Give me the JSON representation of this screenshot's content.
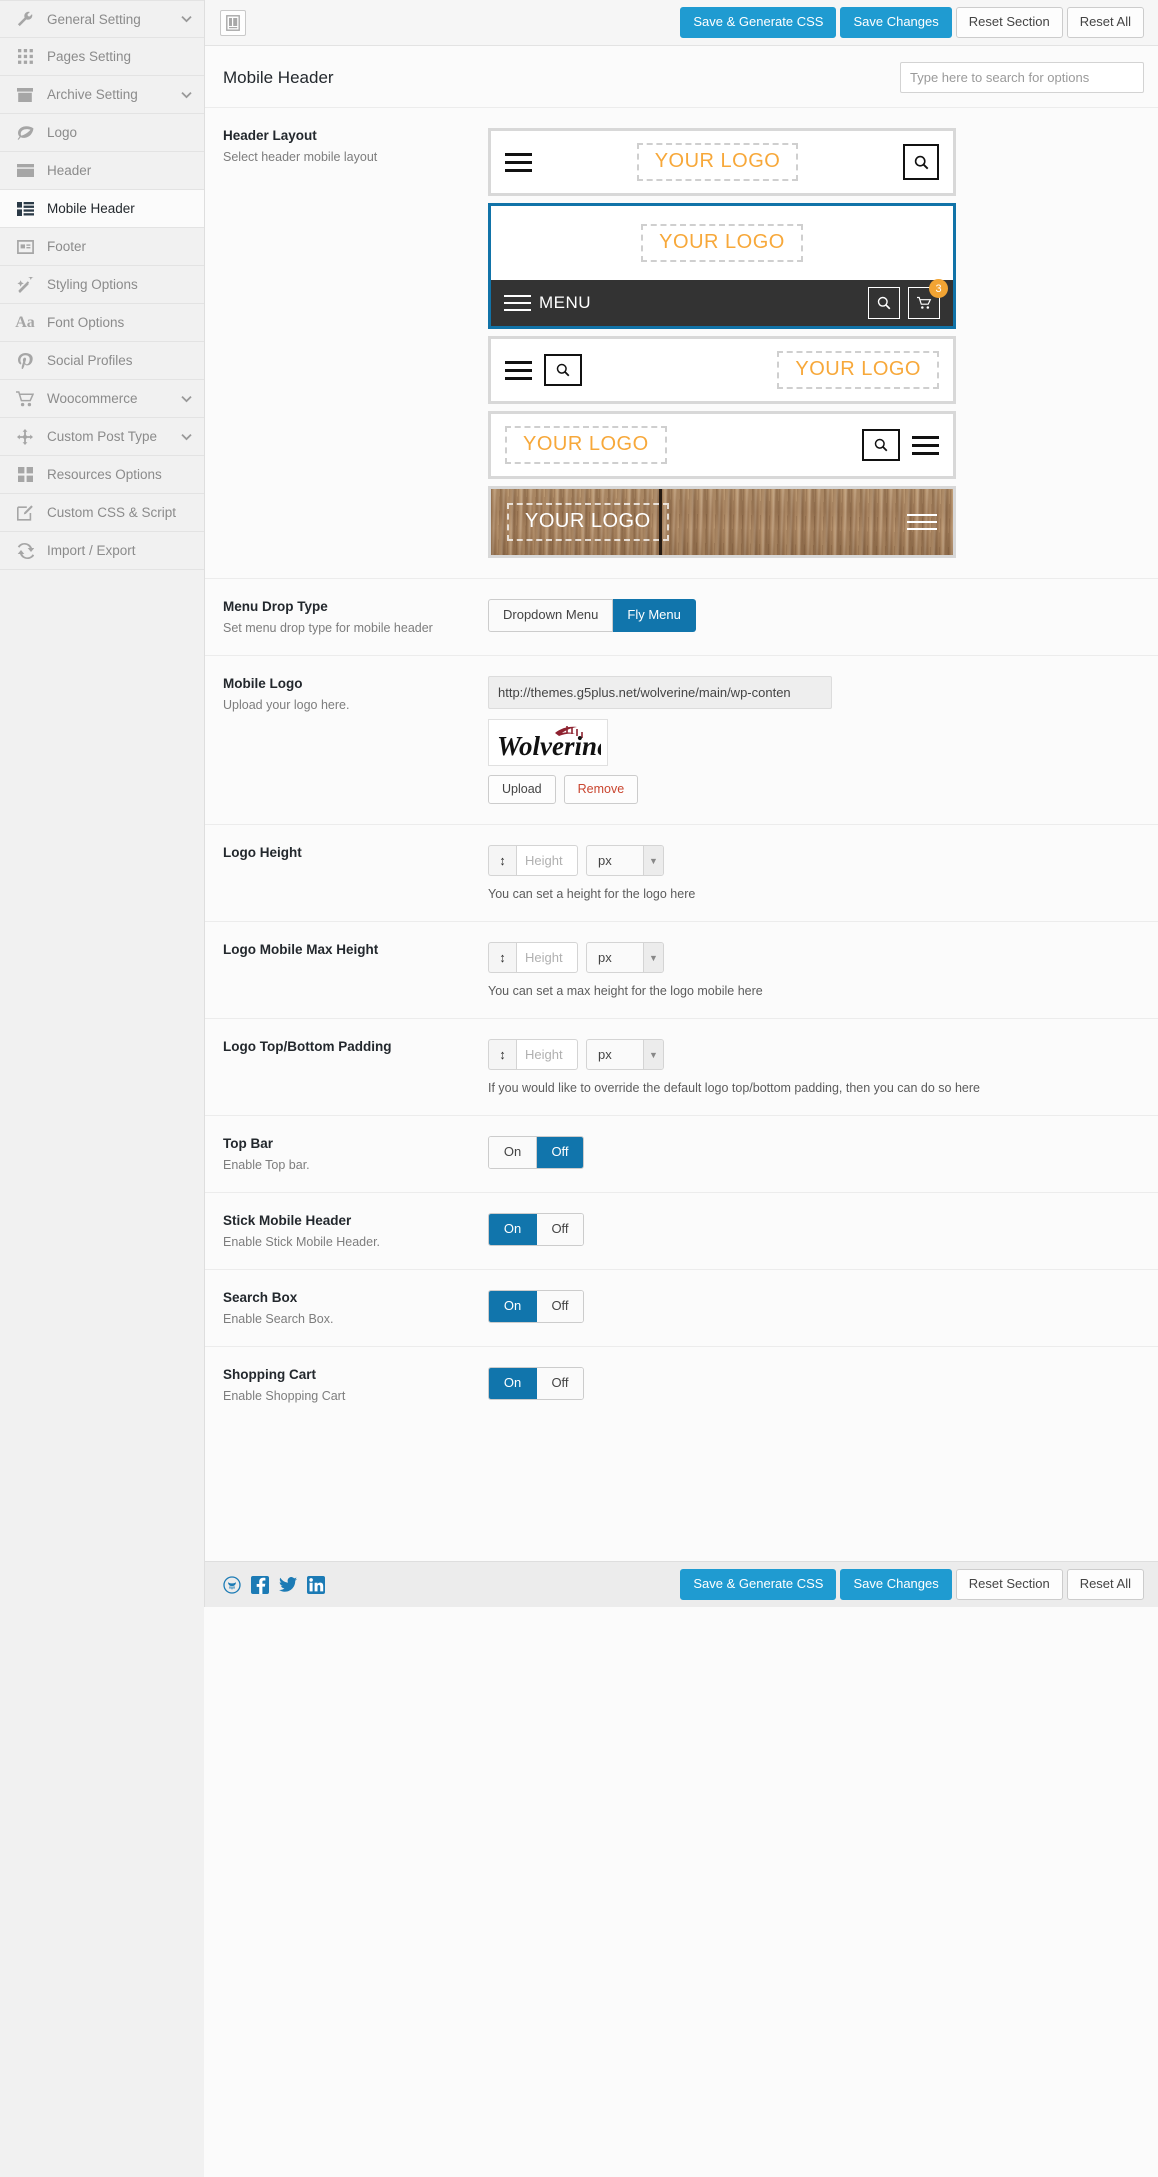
{
  "colors": {
    "accent_blue": "#1f9bd1",
    "toggle_blue": "#1175ac",
    "selected_border": "#1173a8",
    "logo_orange": "#f7a83a",
    "badge_orange": "#f2a433",
    "menubar_dark": "#333333",
    "sidebar_bg": "#f1f1f1"
  },
  "sidebar": {
    "items": [
      {
        "label": "General Setting",
        "icon": "wrench-icon",
        "caret": true,
        "active": false
      },
      {
        "label": "Pages Setting",
        "icon": "grid-dots-icon",
        "caret": false,
        "active": false
      },
      {
        "label": "Archive Setting",
        "icon": "archive-box-icon",
        "caret": true,
        "active": false
      },
      {
        "label": "Logo",
        "icon": "leaf-icon",
        "caret": false,
        "active": false
      },
      {
        "label": "Header",
        "icon": "header-bar-icon",
        "caret": false,
        "active": false
      },
      {
        "label": "Mobile Header",
        "icon": "mobile-list-icon",
        "caret": false,
        "active": true
      },
      {
        "label": "Footer",
        "icon": "footer-box-icon",
        "caret": false,
        "active": false
      },
      {
        "label": "Styling Options",
        "icon": "magic-wand-icon",
        "caret": false,
        "active": false
      },
      {
        "label": "Font Options",
        "icon": "font-aa-icon",
        "caret": false,
        "active": false
      },
      {
        "label": "Social Profiles",
        "icon": "pinterest-p-icon",
        "caret": false,
        "active": false
      },
      {
        "label": "Woocommerce",
        "icon": "shopping-cart-icon",
        "caret": true,
        "active": false
      },
      {
        "label": "Custom Post Type",
        "icon": "move-arrows-icon",
        "caret": true,
        "active": false
      },
      {
        "label": "Resources Options",
        "icon": "squares-icon",
        "caret": false,
        "active": false
      },
      {
        "label": "Custom CSS & Script",
        "icon": "edit-pencil-icon",
        "caret": false,
        "active": false
      },
      {
        "label": "Import / Export",
        "icon": "refresh-icon",
        "caret": false,
        "active": false
      }
    ]
  },
  "toolbar": {
    "panel_icon": "layout-panel-icon",
    "save_generate_css_label": "Save & Generate CSS",
    "save_changes_label": "Save Changes",
    "reset_section_label": "Reset Section",
    "reset_all_label": "Reset All"
  },
  "page": {
    "title": "Mobile Header",
    "search_placeholder": "Type here to search for options"
  },
  "fields": {
    "header_layout": {
      "title": "Header Layout",
      "sub": "Select header mobile layout",
      "logo_text": "YOUR LOGO",
      "menu_text": "MENU",
      "cart_badge": "3",
      "options": [
        {
          "id": "layout-1",
          "selected": false
        },
        {
          "id": "layout-2",
          "selected": true
        },
        {
          "id": "layout-3",
          "selected": false
        },
        {
          "id": "layout-4",
          "selected": false
        },
        {
          "id": "layout-5",
          "selected": false
        }
      ]
    },
    "menu_drop_type": {
      "title": "Menu Drop Type",
      "sub": "Set menu drop type for mobile header",
      "options": [
        {
          "label": "Dropdown Menu",
          "selected": false
        },
        {
          "label": "Fly Menu",
          "selected": true
        }
      ]
    },
    "mobile_logo": {
      "title": "Mobile Logo",
      "sub": "Upload your logo here.",
      "url_value": "http://themes.g5plus.net/wolverine/main/wp-conten",
      "thumb_alt": "Wolverine",
      "upload_label": "Upload",
      "remove_label": "Remove"
    },
    "logo_height": {
      "title": "Logo Height",
      "input_placeholder": "Height",
      "unit": "px",
      "desc": "You can set a height for the logo here"
    },
    "logo_mobile_max_height": {
      "title": "Logo Mobile Max Height",
      "input_placeholder": "Height",
      "unit": "px",
      "desc": "You can set a max height for the logo mobile here"
    },
    "logo_padding": {
      "title": "Logo Top/Bottom Padding",
      "input_placeholder": "Height",
      "unit": "px",
      "desc": "If you would like to override the default logo top/bottom padding, then you can do so here"
    },
    "top_bar": {
      "title": "Top Bar",
      "sub": "Enable Top bar.",
      "on_label": "On",
      "off_label": "Off",
      "state": "Off"
    },
    "stick_mobile_header": {
      "title": "Stick Mobile Header",
      "sub": "Enable Stick Mobile Header.",
      "on_label": "On",
      "off_label": "Off",
      "state": "On"
    },
    "search_box": {
      "title": "Search Box",
      "sub": "Enable Search Box.",
      "on_label": "On",
      "off_label": "Off",
      "state": "On"
    },
    "shopping_cart": {
      "title": "Shopping Cart",
      "sub": "Enable Shopping Cart",
      "on_label": "On",
      "off_label": "Off",
      "state": "On"
    }
  },
  "footer": {
    "socials": [
      {
        "name": "dribbble-icon"
      },
      {
        "name": "facebook-icon"
      },
      {
        "name": "twitter-icon"
      },
      {
        "name": "linkedin-icon"
      }
    ],
    "save_generate_css_label": "Save & Generate CSS",
    "save_changes_label": "Save Changes",
    "reset_section_label": "Reset Section",
    "reset_all_label": "Reset All"
  }
}
